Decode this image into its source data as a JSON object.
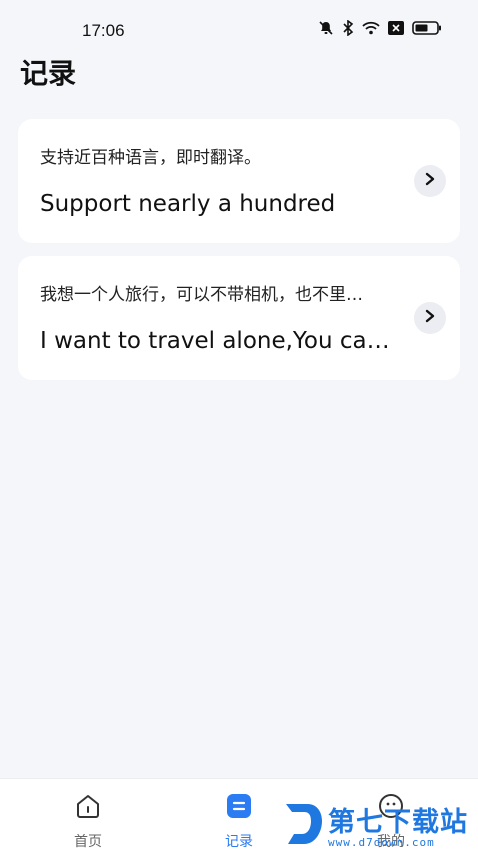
{
  "status_bar": {
    "time": "17:06",
    "icons": [
      "mute-bell-icon",
      "bluetooth-icon",
      "wifi-icon",
      "sim-off-icon",
      "battery-icon"
    ]
  },
  "page": {
    "title": "记录"
  },
  "records": [
    {
      "source": "支持近百种语言，即时翻译。",
      "translation": "Support nearly a hundred"
    },
    {
      "source": "我想一个人旅行，可以不带相机，也不里…",
      "translation": "I want to travel alone,You ca…"
    }
  ],
  "bottom_nav": {
    "items": [
      {
        "label": "首页",
        "icon": "home-icon"
      },
      {
        "label": "记录",
        "icon": "record-icon",
        "active": true
      },
      {
        "label": "我的",
        "icon": "profile-icon"
      }
    ],
    "active_color": "#2b7bf3"
  },
  "watermark": {
    "text": "第七下载站",
    "url": "www.d7down.com"
  }
}
